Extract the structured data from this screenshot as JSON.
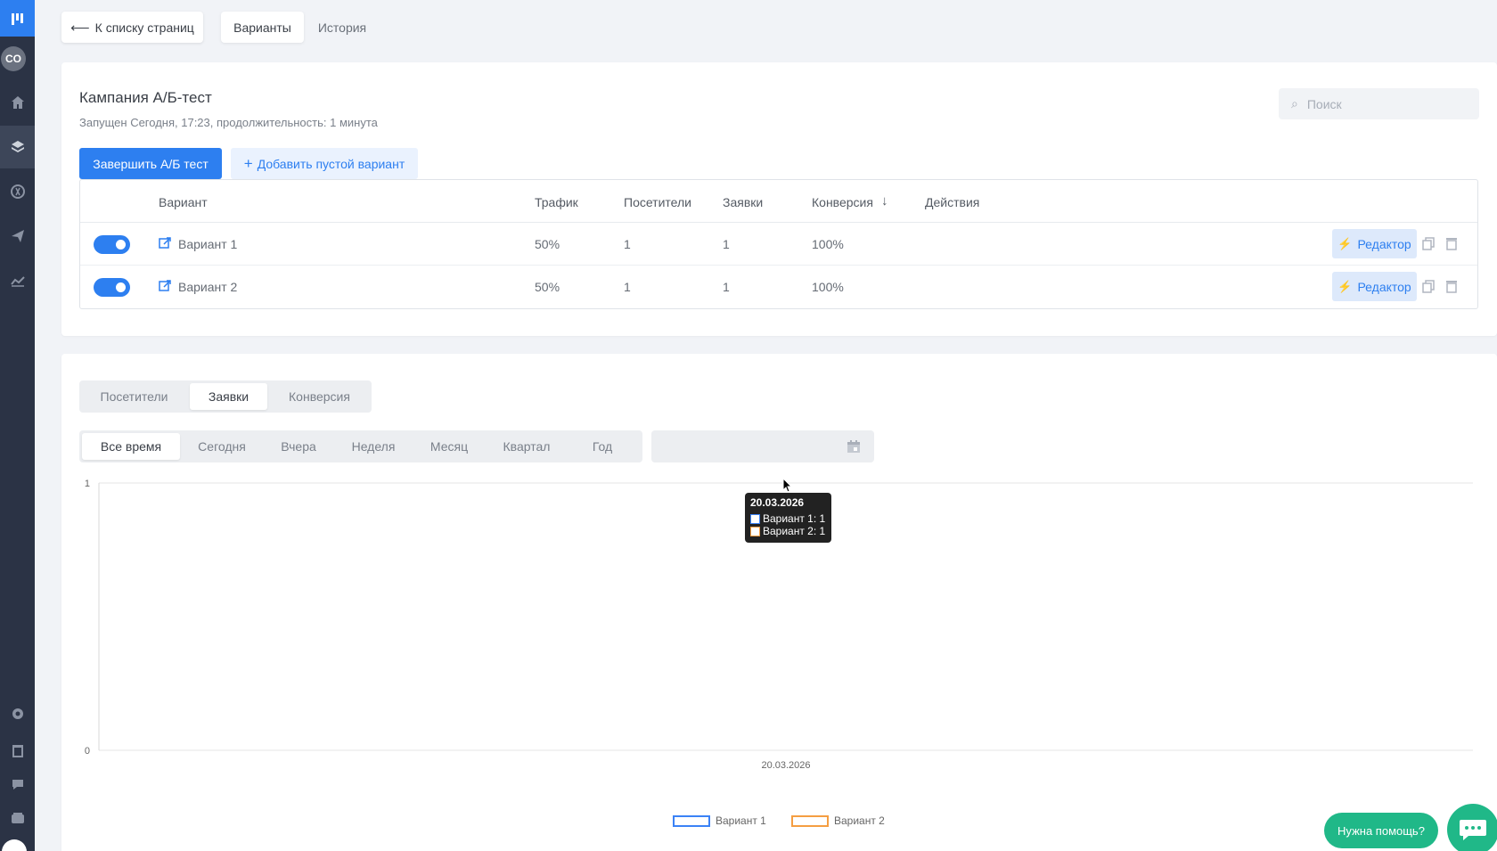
{
  "sidebar": {
    "avatar_initials": "CO",
    "items": [
      "home-icon",
      "layers-icon",
      "leads-icon",
      "send-icon",
      "analytics-icon",
      "settings-icon",
      "trash-icon",
      "help-icon",
      "wallet-icon"
    ]
  },
  "topbar": {
    "back_label": "К списку страниц",
    "tabs": [
      {
        "label": "Варианты",
        "active": true
      },
      {
        "label": "История",
        "active": false
      }
    ]
  },
  "campaign": {
    "title": "Кампания А/Б-тест",
    "subtitle": "Запущен Сегодня, 17:23, продолжительность: 1 минута",
    "search_placeholder": "Поиск",
    "finish_button": "Завершить А/Б тест",
    "add_variant_button": "Добавить пустой вариант"
  },
  "table": {
    "headers": {
      "variant": "Вариант",
      "traffic": "Трафик",
      "visitors": "Посетители",
      "leads": "Заявки",
      "conversion": "Конверсия",
      "conversion_sort": "↓",
      "actions": "Действия"
    },
    "rows": [
      {
        "enabled": true,
        "name": "Вариант 1",
        "traffic": "50%",
        "visitors": "1",
        "leads": "1",
        "conversion": "100%",
        "editor": "Редактор"
      },
      {
        "enabled": true,
        "name": "Вариант 2",
        "traffic": "50%",
        "visitors": "1",
        "leads": "1",
        "conversion": "100%",
        "editor": "Редактор"
      }
    ]
  },
  "stats": {
    "metric_tabs": [
      {
        "label": "Посетители",
        "active": false
      },
      {
        "label": "Заявки",
        "active": true
      },
      {
        "label": "Конверсия",
        "active": false
      }
    ],
    "period_tabs": [
      {
        "label": "Все время",
        "active": true
      },
      {
        "label": "Сегодня",
        "active": false
      },
      {
        "label": "Вчера",
        "active": false
      },
      {
        "label": "Неделя",
        "active": false
      },
      {
        "label": "Месяц",
        "active": false
      },
      {
        "label": "Квартал",
        "active": false
      },
      {
        "label": "Год",
        "active": false
      }
    ],
    "date_range_value": ""
  },
  "chart_data": {
    "type": "line",
    "x": [
      "20.03.2026"
    ],
    "series": [
      {
        "name": "Вариант 1",
        "values": [
          1
        ],
        "color": "#3b82f6"
      },
      {
        "name": "Вариант 2",
        "values": [
          1
        ],
        "color": "#f59e42"
      }
    ],
    "y_ticks": [
      "1",
      "0"
    ],
    "x_ticks": [
      "20.03.2026"
    ],
    "ylim": [
      0,
      1
    ],
    "grid": true,
    "legend_position": "bottom"
  },
  "tooltip": {
    "date": "20.03.2026",
    "row1": "Вариант 1: 1",
    "row2": "Вариант 2: 1"
  },
  "help": {
    "label": "Нужна помощь?"
  }
}
